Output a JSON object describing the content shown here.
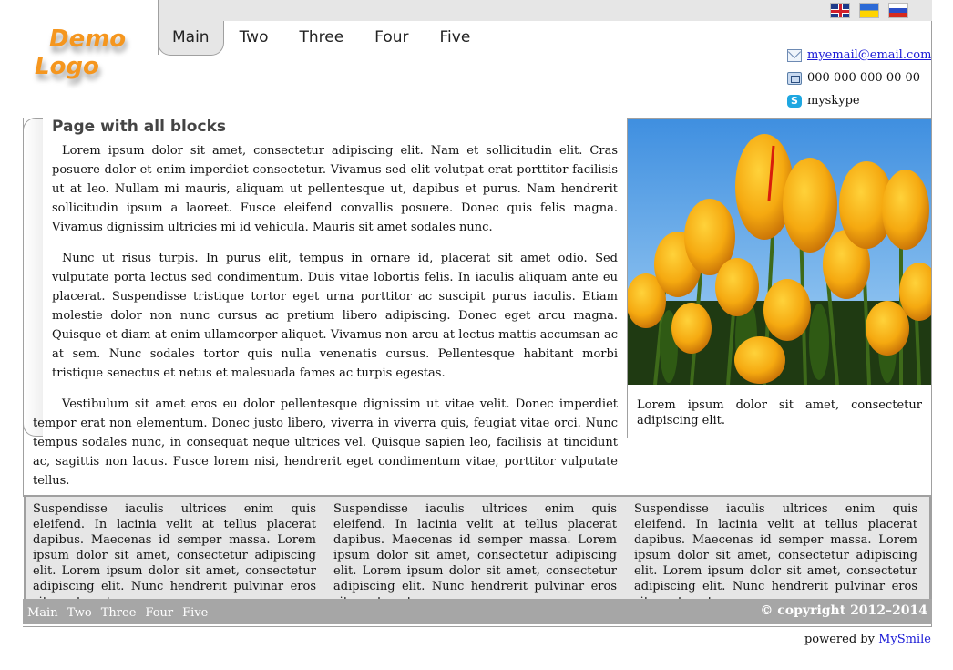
{
  "logo": {
    "line1": "Demo",
    "line2": "Logo"
  },
  "languages": [
    {
      "name": "english-flag-icon"
    },
    {
      "name": "ukrainian-flag-icon"
    },
    {
      "name": "russian-flag-icon"
    }
  ],
  "nav": {
    "items": [
      "Main",
      "Two",
      "Three",
      "Four",
      "Five"
    ],
    "active": "Main"
  },
  "contacts": {
    "email": "myemail@email.com",
    "phone": "000 000 000 00 00",
    "skype": "myskype"
  },
  "main": {
    "title": "Page with all blocks",
    "paragraphs": [
      "Lorem ipsum dolor sit amet, consectetur adipiscing elit. Nam et sollicitudin elit. Cras posuere dolor et enim imperdiet consectetur. Vivamus sed elit volutpat erat porttitor facilisis ut at leo. Nullam mi mauris, aliquam ut pellentesque ut, dapibus et purus. Nam hendrerit sollicitudin ipsum a laoreet. Fusce eleifend convallis posuere. Donec quis felis magna. Vivamus dignissim ultricies mi id vehicula. Mauris sit amet sodales nunc.",
      "Nunc ut risus turpis. In purus elit, tempus in ornare id, placerat sit amet odio. Sed vulputate porta lectus sed condimentum. Duis vitae lobortis felis. In iaculis aliquam ante eu placerat. Suspendisse tristique tortor eget urna porttitor ac suscipit purus iaculis. Etiam molestie dolor non nunc cursus ac pretium libero adipiscing. Donec eget arcu magna. Quisque et diam at enim ullamcorper aliquet. Vivamus non arcu at lectus mattis accumsan ac at sem. Nunc sodales tortor quis nulla venenatis cursus. Pellentesque habitant morbi tristique senectus et netus et malesuada fames ac turpis egestas.",
      "Vestibulum sit amet eros eu dolor pellentesque dignissim ut vitae velit. Donec imperdiet tempor erat non elementum. Donec justo libero, viverra in viverra quis, feugiat vitae orci. Nunc tempus sodales nunc, in consequat neque ultrices vel. Quisque sapien leo, facilisis at tincidunt ac, sagittis non lacus. Fusce lorem nisi, hendrerit eget condimentum vitae, porttitor vulputate tellus."
    ]
  },
  "image_box": {
    "caption": "Lorem ipsum dolor sit amet, consectetur adipiscing elit."
  },
  "footer": {
    "columns": [
      "Suspendisse iaculis ultrices enim quis eleifend. In lacinia velit at tellus placerat dapibus. Maecenas id semper massa. Lorem ipsum dolor sit amet, consectetur adipiscing elit. Lorem ipsum dolor sit amet, consectetur adipiscing elit. Nunc hendrerit pulvinar eros sit amet auctor.",
      "Suspendisse iaculis ultrices enim quis eleifend. In lacinia velit at tellus placerat dapibus. Maecenas id semper massa. Lorem ipsum dolor sit amet, consectetur adipiscing elit. Lorem ipsum dolor sit amet, consectetur adipiscing elit. Nunc hendrerit pulvinar eros sit amet auctor.",
      "Suspendisse iaculis ultrices enim quis eleifend. In lacinia velit at tellus placerat dapibus. Maecenas id semper massa. Lorem ipsum dolor sit amet, consectetur adipiscing elit. Lorem ipsum dolor sit amet, consectetur adipiscing elit. Nunc hendrerit pulvinar eros sit amet auctor."
    ],
    "nav": [
      "Main",
      "Two",
      "Three",
      "Four",
      "Five"
    ],
    "copyright": "© copyright 2012–2014",
    "powered_prefix": "powered by",
    "powered_link": "MySmile"
  },
  "colors": {
    "logo": "#f5961e",
    "band": "#e6e6e6",
    "bottom_bar": "#a6a6a6",
    "link": "#1a1ad6"
  }
}
